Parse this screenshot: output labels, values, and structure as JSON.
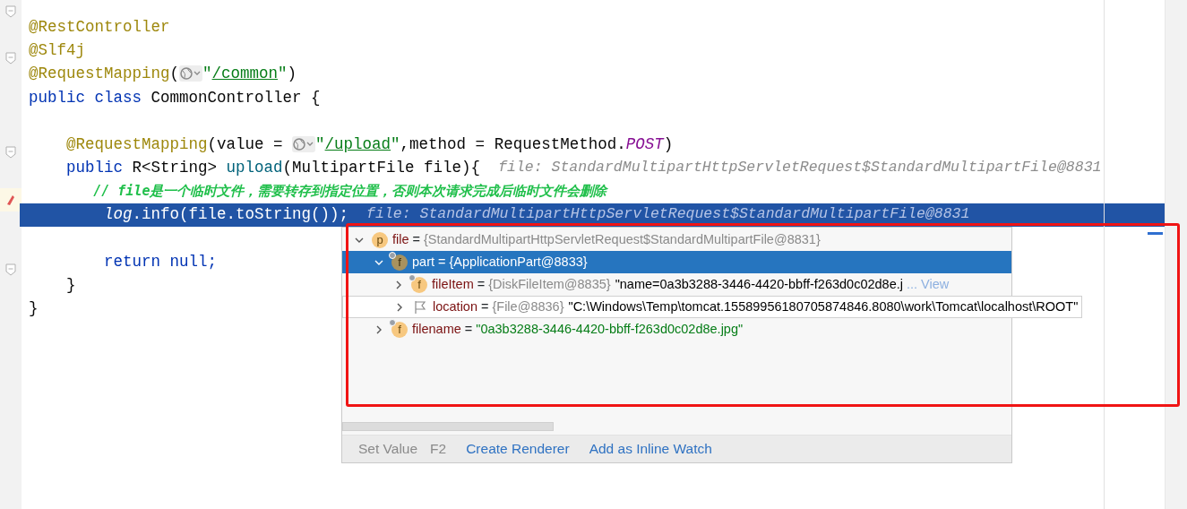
{
  "editor": {
    "lines": [
      {
        "kind": "fold",
        "highlighted": false,
        "tokens": [
          {
            "kind": "annotation",
            "text": "@RestController"
          }
        ]
      },
      {
        "kind": "plain",
        "highlighted": false,
        "tokens": [
          {
            "kind": "annotation",
            "text": "@Slf4j"
          }
        ]
      },
      {
        "kind": "fold",
        "highlighted": false,
        "tokens": [
          {
            "kind": "annotation",
            "text": "@RequestMapping"
          },
          {
            "kind": "plain",
            "text": "("
          },
          {
            "kind": "globe"
          },
          {
            "kind": "string",
            "text": "\""
          },
          {
            "kind": "url",
            "text": "/common"
          },
          {
            "kind": "string",
            "text": "\""
          },
          {
            "kind": "plain",
            "text": ")"
          }
        ]
      },
      {
        "kind": "plain",
        "highlighted": false,
        "tokens": [
          {
            "kind": "keyword",
            "text": "public class "
          },
          {
            "kind": "plain",
            "text": "CommonController {"
          }
        ]
      },
      {
        "kind": "plain",
        "highlighted": false
      },
      {
        "kind": "plain",
        "highlighted": false,
        "tokens": [
          {
            "kind": "annotation",
            "text": "    @RequestMapping"
          },
          {
            "kind": "plain",
            "text": "(value = "
          },
          {
            "kind": "globe"
          },
          {
            "kind": "string",
            "text": "\""
          },
          {
            "kind": "url",
            "text": "/upload"
          },
          {
            "kind": "string",
            "text": "\""
          },
          {
            "kind": "plain",
            "text": ",method = RequestMethod."
          },
          {
            "kind": "constant",
            "text": "POST"
          },
          {
            "kind": "plain",
            "text": ")"
          }
        ]
      },
      {
        "kind": "fold",
        "highlighted": false,
        "tokens": [
          {
            "kind": "keyword",
            "text": "    public "
          },
          {
            "kind": "plain",
            "text": "R<String> "
          },
          {
            "kind": "method",
            "text": "upload"
          },
          {
            "kind": "plain",
            "text": "(MultipartFile file){"
          },
          {
            "kind": "hint",
            "text": "file: StandardMultipartHttpServletRequest$StandardMultipartFile@8831"
          }
        ]
      },
      {
        "kind": "plain",
        "highlighted": false,
        "tokens": [
          {
            "kind": "comment",
            "text": "        // file是一个临时文件，需要转存到指定位置，否则本次请求完成后临时文件会删除"
          }
        ]
      },
      {
        "kind": "breakpoint",
        "highlighted": true,
        "tokens": [
          {
            "kind": "constant",
            "text": "        log"
          },
          {
            "kind": "plain",
            "text": ".info(file.toString());"
          },
          {
            "kind": "hint",
            "text": "file: StandardMultipartHttpServletRequest$StandardMultipartFile@8831"
          }
        ]
      },
      {
        "kind": "plain",
        "highlighted": false
      },
      {
        "kind": "plain",
        "highlighted": false,
        "tokens": [
          {
            "kind": "keyword",
            "text": "        return null;"
          }
        ]
      },
      {
        "kind": "fold",
        "highlighted": false,
        "tokens": [
          {
            "kind": "plain",
            "text": "    }"
          }
        ]
      },
      {
        "kind": "plain",
        "highlighted": false,
        "tokens": [
          {
            "kind": "plain",
            "text": "}"
          }
        ]
      }
    ]
  },
  "popup": {
    "tree": [
      {
        "name": "file",
        "kind": "parameter",
        "letter": "p",
        "operator": "=",
        "type": "{StandardMultipartHttpServletRequest$StandardMultipartFile@8831}",
        "expanded": true,
        "selected": false,
        "hovered": false,
        "children": [
          {
            "name": "part",
            "kind": "field",
            "letter": "f",
            "operator": "=",
            "type": "{ApplicationPart@8833}",
            "expanded": true,
            "selected": true,
            "hovered": false,
            "children": [
              {
                "name": "fileItem",
                "kind": "field",
                "letter": "f",
                "operator": "=",
                "type": "{DiskFileItem@8835}",
                "value": {
                  "kind": "text",
                  "text": "\"name=0a3b3288-3446-4420-bbff-f263d0c02d8e.j"
                },
                "more": "... View",
                "expanded": false,
                "selected": false,
                "hovered": false
              },
              {
                "name": "location",
                "kind": "flag",
                "operator": "=",
                "type": "{File@8836}",
                "value": {
                  "kind": "text",
                  "text": "\"C:\\Windows\\Temp\\tomcat.15589956180705874846.8080\\work\\Tomcat\\localhost\\ROOT\""
                },
                "expanded": false,
                "selected": false,
                "hovered": true
              }
            ]
          },
          {
            "name": "filename",
            "kind": "field",
            "letter": "f",
            "operator": "=",
            "value": {
              "kind": "string",
              "text": "\"0a3b3288-3446-4420-bbff-f263d0c02d8e.jpg\""
            },
            "expanded": false,
            "selected": false,
            "hovered": false
          }
        ]
      }
    ],
    "actions": [
      {
        "label": "Set Value",
        "shortcut": "F2",
        "disabled": true
      },
      {
        "label": "Create Renderer",
        "disabled": false
      },
      {
        "label": "Add as Inline Watch",
        "disabled": false
      }
    ]
  }
}
